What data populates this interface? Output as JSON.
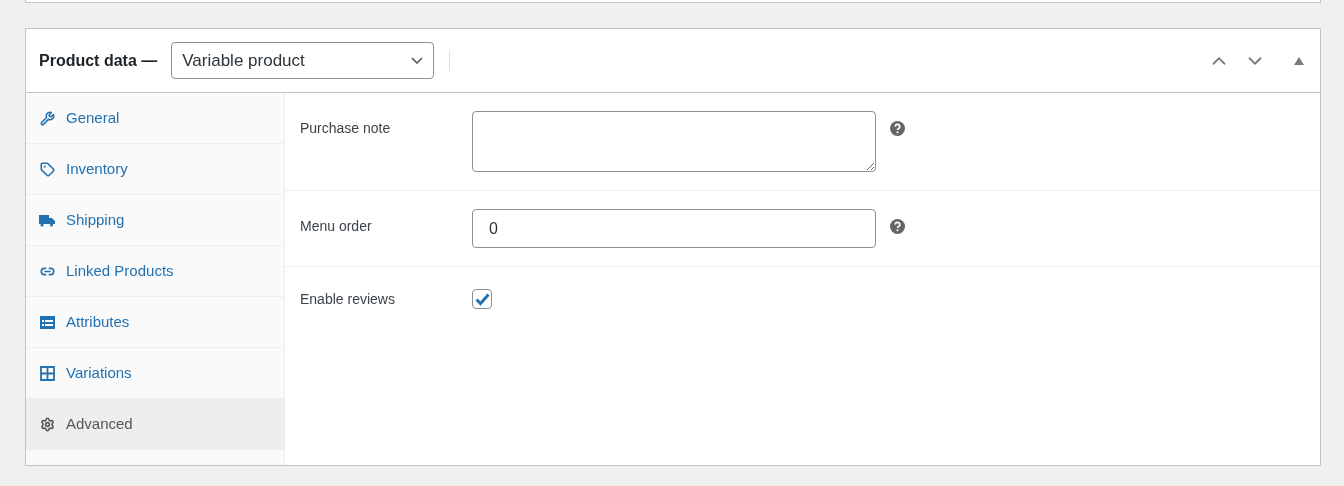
{
  "header": {
    "title": "Product data —",
    "product_type": "Variable product"
  },
  "tabs": [
    {
      "label": "General",
      "kind": "wrench",
      "selected": false
    },
    {
      "label": "Inventory",
      "kind": "tag",
      "selected": false
    },
    {
      "label": "Shipping",
      "kind": "truck",
      "selected": false
    },
    {
      "label": "Linked Products",
      "kind": "link",
      "selected": false
    },
    {
      "label": "Attributes",
      "kind": "list",
      "selected": false
    },
    {
      "label": "Variations",
      "kind": "grid",
      "selected": false
    },
    {
      "label": "Advanced",
      "kind": "gear",
      "selected": true
    }
  ],
  "fields": [
    {
      "kind": "textarea",
      "label": "Purchase note",
      "help": true
    },
    {
      "kind": "text",
      "label": "Menu order",
      "value": "0",
      "help": true
    },
    {
      "kind": "checkbox",
      "label": "Enable reviews",
      "checked": true,
      "help": false
    }
  ]
}
